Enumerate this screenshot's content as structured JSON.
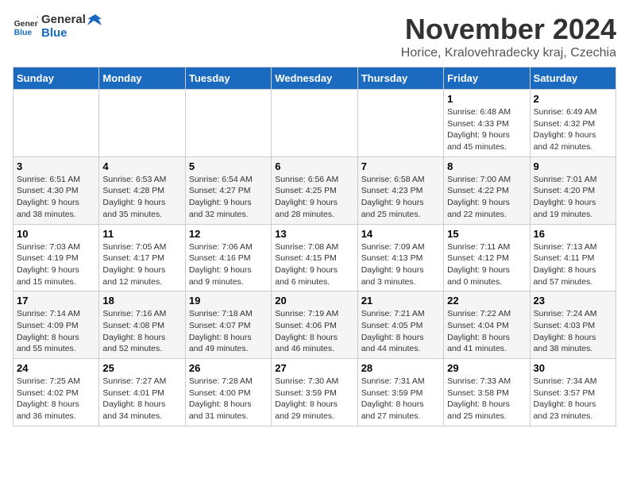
{
  "header": {
    "logo": {
      "general": "General",
      "blue": "Blue"
    },
    "title": "November 2024",
    "location": "Horice, Kralovehradecky kraj, Czechia"
  },
  "days_of_week": [
    "Sunday",
    "Monday",
    "Tuesday",
    "Wednesday",
    "Thursday",
    "Friday",
    "Saturday"
  ],
  "weeks": [
    [
      {
        "day": "",
        "info": ""
      },
      {
        "day": "",
        "info": ""
      },
      {
        "day": "",
        "info": ""
      },
      {
        "day": "",
        "info": ""
      },
      {
        "day": "",
        "info": ""
      },
      {
        "day": "1",
        "info": "Sunrise: 6:48 AM\nSunset: 4:33 PM\nDaylight: 9 hours\nand 45 minutes."
      },
      {
        "day": "2",
        "info": "Sunrise: 6:49 AM\nSunset: 4:32 PM\nDaylight: 9 hours\nand 42 minutes."
      }
    ],
    [
      {
        "day": "3",
        "info": "Sunrise: 6:51 AM\nSunset: 4:30 PM\nDaylight: 9 hours\nand 38 minutes."
      },
      {
        "day": "4",
        "info": "Sunrise: 6:53 AM\nSunset: 4:28 PM\nDaylight: 9 hours\nand 35 minutes."
      },
      {
        "day": "5",
        "info": "Sunrise: 6:54 AM\nSunset: 4:27 PM\nDaylight: 9 hours\nand 32 minutes."
      },
      {
        "day": "6",
        "info": "Sunrise: 6:56 AM\nSunset: 4:25 PM\nDaylight: 9 hours\nand 28 minutes."
      },
      {
        "day": "7",
        "info": "Sunrise: 6:58 AM\nSunset: 4:23 PM\nDaylight: 9 hours\nand 25 minutes."
      },
      {
        "day": "8",
        "info": "Sunrise: 7:00 AM\nSunset: 4:22 PM\nDaylight: 9 hours\nand 22 minutes."
      },
      {
        "day": "9",
        "info": "Sunrise: 7:01 AM\nSunset: 4:20 PM\nDaylight: 9 hours\nand 19 minutes."
      }
    ],
    [
      {
        "day": "10",
        "info": "Sunrise: 7:03 AM\nSunset: 4:19 PM\nDaylight: 9 hours\nand 15 minutes."
      },
      {
        "day": "11",
        "info": "Sunrise: 7:05 AM\nSunset: 4:17 PM\nDaylight: 9 hours\nand 12 minutes."
      },
      {
        "day": "12",
        "info": "Sunrise: 7:06 AM\nSunset: 4:16 PM\nDaylight: 9 hours\nand 9 minutes."
      },
      {
        "day": "13",
        "info": "Sunrise: 7:08 AM\nSunset: 4:15 PM\nDaylight: 9 hours\nand 6 minutes."
      },
      {
        "day": "14",
        "info": "Sunrise: 7:09 AM\nSunset: 4:13 PM\nDaylight: 9 hours\nand 3 minutes."
      },
      {
        "day": "15",
        "info": "Sunrise: 7:11 AM\nSunset: 4:12 PM\nDaylight: 9 hours\nand 0 minutes."
      },
      {
        "day": "16",
        "info": "Sunrise: 7:13 AM\nSunset: 4:11 PM\nDaylight: 8 hours\nand 57 minutes."
      }
    ],
    [
      {
        "day": "17",
        "info": "Sunrise: 7:14 AM\nSunset: 4:09 PM\nDaylight: 8 hours\nand 55 minutes."
      },
      {
        "day": "18",
        "info": "Sunrise: 7:16 AM\nSunset: 4:08 PM\nDaylight: 8 hours\nand 52 minutes."
      },
      {
        "day": "19",
        "info": "Sunrise: 7:18 AM\nSunset: 4:07 PM\nDaylight: 8 hours\nand 49 minutes."
      },
      {
        "day": "20",
        "info": "Sunrise: 7:19 AM\nSunset: 4:06 PM\nDaylight: 8 hours\nand 46 minutes."
      },
      {
        "day": "21",
        "info": "Sunrise: 7:21 AM\nSunset: 4:05 PM\nDaylight: 8 hours\nand 44 minutes."
      },
      {
        "day": "22",
        "info": "Sunrise: 7:22 AM\nSunset: 4:04 PM\nDaylight: 8 hours\nand 41 minutes."
      },
      {
        "day": "23",
        "info": "Sunrise: 7:24 AM\nSunset: 4:03 PM\nDaylight: 8 hours\nand 38 minutes."
      }
    ],
    [
      {
        "day": "24",
        "info": "Sunrise: 7:25 AM\nSunset: 4:02 PM\nDaylight: 8 hours\nand 36 minutes."
      },
      {
        "day": "25",
        "info": "Sunrise: 7:27 AM\nSunset: 4:01 PM\nDaylight: 8 hours\nand 34 minutes."
      },
      {
        "day": "26",
        "info": "Sunrise: 7:28 AM\nSunset: 4:00 PM\nDaylight: 8 hours\nand 31 minutes."
      },
      {
        "day": "27",
        "info": "Sunrise: 7:30 AM\nSunset: 3:59 PM\nDaylight: 8 hours\nand 29 minutes."
      },
      {
        "day": "28",
        "info": "Sunrise: 7:31 AM\nSunset: 3:59 PM\nDaylight: 8 hours\nand 27 minutes."
      },
      {
        "day": "29",
        "info": "Sunrise: 7:33 AM\nSunset: 3:58 PM\nDaylight: 8 hours\nand 25 minutes."
      },
      {
        "day": "30",
        "info": "Sunrise: 7:34 AM\nSunset: 3:57 PM\nDaylight: 8 hours\nand 23 minutes."
      }
    ]
  ]
}
